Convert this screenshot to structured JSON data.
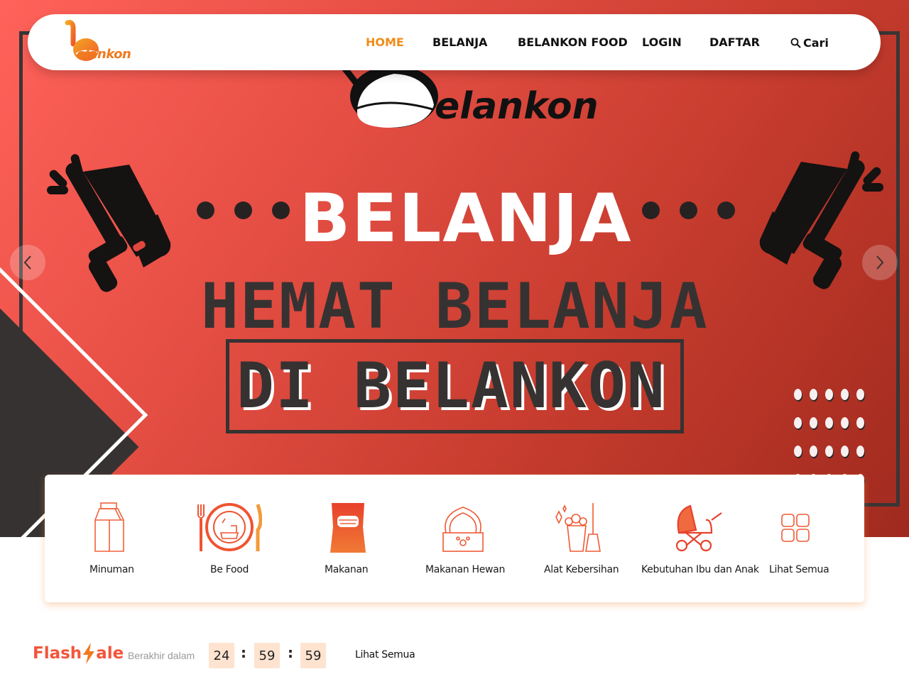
{
  "brand": {
    "logo_text": "elankon",
    "accent": "#f08c18"
  },
  "nav": {
    "items": [
      {
        "label": "HOME",
        "active": true
      },
      {
        "label": "BELANJA",
        "active": false
      },
      {
        "label": "BELANKON FOOD",
        "active": false
      },
      {
        "label": "LOGIN",
        "active": false
      },
      {
        "label": "DAFTAR",
        "active": false
      }
    ],
    "search_label": "Cari",
    "search_icon": "search-icon"
  },
  "banner": {
    "logo_text": "elankon",
    "title": "BELANJA",
    "subtitle": "HEMAT BELANJA",
    "boxed_text": "DI BELANKON",
    "prev_icon": "chevron-left-icon",
    "next_icon": "chevron-right-icon",
    "colors": {
      "background": "#e0483d",
      "dark": "#363232"
    }
  },
  "categories": [
    {
      "label": "Minuman",
      "icon": "milk-carton-icon"
    },
    {
      "label": "Be Food",
      "icon": "plate-cutlery-icon"
    },
    {
      "label": "Makanan",
      "icon": "chips-bag-icon"
    },
    {
      "label": "Makanan Hewan",
      "icon": "pet-bowl-icon"
    },
    {
      "label": "Alat Kebersihan",
      "icon": "cleaning-bucket-icon"
    },
    {
      "label": "Kebutuhan Ibu dan Anak",
      "icon": "baby-stroller-icon"
    },
    {
      "label": "Lihat Semua",
      "icon": "grid-icon"
    }
  ],
  "flash_sale": {
    "title_left": "Flash",
    "title_right": "ale",
    "ends_in_label": "Berakhir dalam",
    "timer": {
      "hours": "24",
      "minutes": "59",
      "seconds": "59"
    },
    "see_all_label": "Lihat Semua",
    "accent": "#f2553a"
  }
}
